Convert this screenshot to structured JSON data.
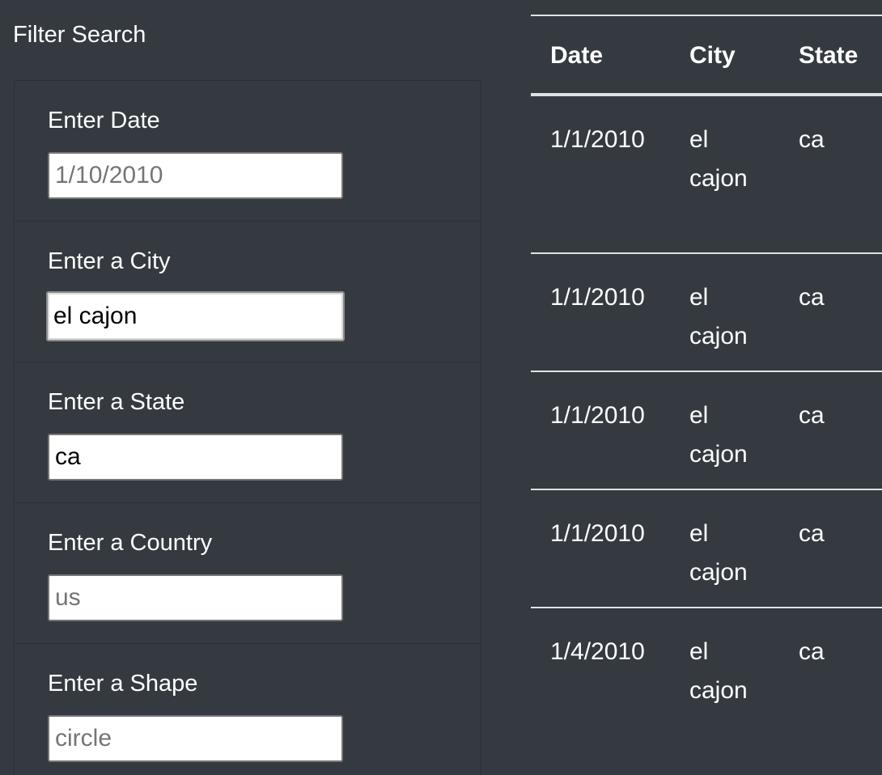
{
  "filter": {
    "title": "Filter Search",
    "fields": [
      {
        "label": "Enter Date",
        "value": "",
        "placeholder": "1/10/2010"
      },
      {
        "label": "Enter a City",
        "value": "el cajon",
        "placeholder": ""
      },
      {
        "label": "Enter a State",
        "value": "ca",
        "placeholder": ""
      },
      {
        "label": "Enter a Country",
        "value": "",
        "placeholder": "us"
      },
      {
        "label": "Enter a Shape",
        "value": "",
        "placeholder": "circle"
      }
    ]
  },
  "table": {
    "headers": [
      "Date",
      "City",
      "State"
    ],
    "rows": [
      [
        "1/1/2010",
        "el cajon",
        "ca"
      ],
      [
        "1/1/2010",
        "el cajon",
        "ca"
      ],
      [
        "1/1/2010",
        "el cajon",
        "ca"
      ],
      [
        "1/1/2010",
        "el cajon",
        "ca"
      ],
      [
        "1/4/2010",
        "el cajon",
        "ca"
      ]
    ]
  }
}
